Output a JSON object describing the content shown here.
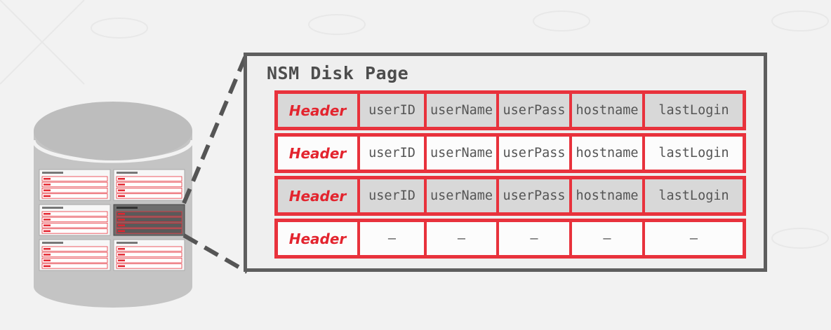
{
  "nsm_page": {
    "title": "NSM Disk Page",
    "rows": [
      {
        "shade": "gray",
        "cells": [
          "Header",
          "userID",
          "userName",
          "userPass",
          "hostname",
          "lastLogin"
        ]
      },
      {
        "shade": "white",
        "cells": [
          "Header",
          "userID",
          "userName",
          "userPass",
          "hostname",
          "lastLogin"
        ]
      },
      {
        "shade": "gray",
        "cells": [
          "Header",
          "userID",
          "userName",
          "userPass",
          "hostname",
          "lastLogin"
        ]
      },
      {
        "shade": "white",
        "cells": [
          "Header",
          "–",
          "–",
          "–",
          "–",
          "–"
        ]
      }
    ]
  },
  "colors": {
    "accent_red": "#e8323c",
    "frame_gray": "#5e5e5e",
    "disk_gray": "#c4c4c4"
  }
}
